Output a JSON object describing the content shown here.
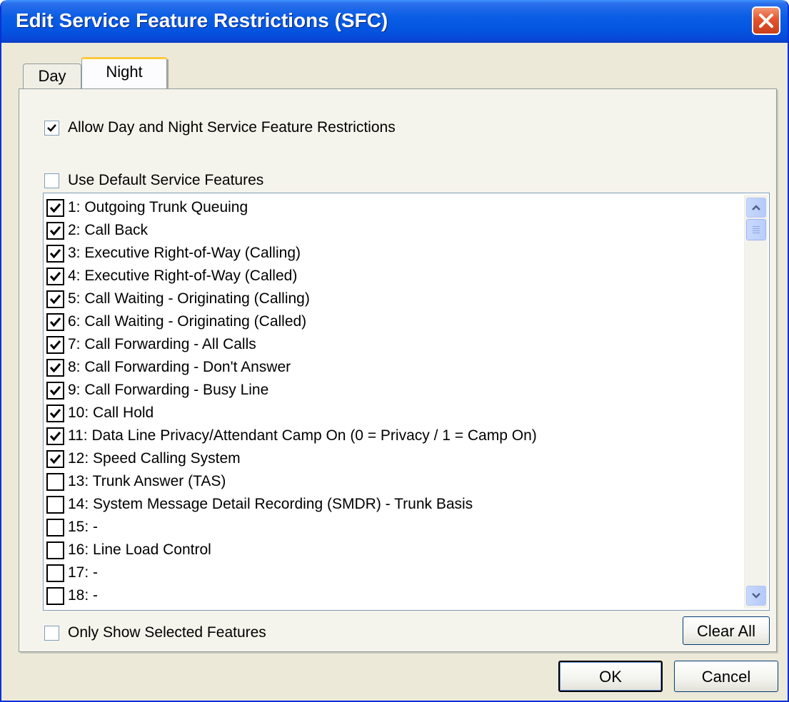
{
  "window": {
    "title": "Edit Service Feature Restrictions (SFC)"
  },
  "tabs": [
    {
      "label": "Day",
      "selected": false
    },
    {
      "label": "Night",
      "selected": true
    }
  ],
  "options": {
    "allow_day_night": {
      "label": "Allow Day and Night Service Feature Restrictions",
      "checked": true
    },
    "use_default": {
      "label": "Use Default Service Features",
      "checked": false
    },
    "only_show_selected": {
      "label": "Only Show Selected Features",
      "checked": false
    }
  },
  "features": [
    {
      "label": "1: Outgoing Trunk Queuing",
      "checked": true
    },
    {
      "label": "2: Call Back",
      "checked": true
    },
    {
      "label": "3: Executive Right-of-Way (Calling)",
      "checked": true
    },
    {
      "label": "4: Executive Right-of-Way (Called)",
      "checked": true
    },
    {
      "label": "5: Call Waiting - Originating (Calling)",
      "checked": true
    },
    {
      "label": "6: Call Waiting - Originating (Called)",
      "checked": true
    },
    {
      "label": "7: Call Forwarding - All Calls",
      "checked": true
    },
    {
      "label": "8: Call Forwarding - Don't Answer",
      "checked": true
    },
    {
      "label": "9: Call Forwarding - Busy Line",
      "checked": true
    },
    {
      "label": "10: Call Hold",
      "checked": true
    },
    {
      "label": "11: Data Line Privacy/Attendant Camp On (0 = Privacy / 1 = Camp On)",
      "checked": true
    },
    {
      "label": "12: Speed Calling System",
      "checked": true
    },
    {
      "label": "13: Trunk Answer (TAS)",
      "checked": false
    },
    {
      "label": "14: System Message Detail Recording (SMDR) - Trunk Basis",
      "checked": false
    },
    {
      "label": "15: -",
      "checked": false
    },
    {
      "label": "16: Line Load Control",
      "checked": false
    },
    {
      "label": "17: -",
      "checked": false
    },
    {
      "label": "18: -",
      "checked": false
    }
  ],
  "buttons": {
    "clear_all": "Clear All",
    "ok": "OK",
    "cancel": "Cancel"
  }
}
